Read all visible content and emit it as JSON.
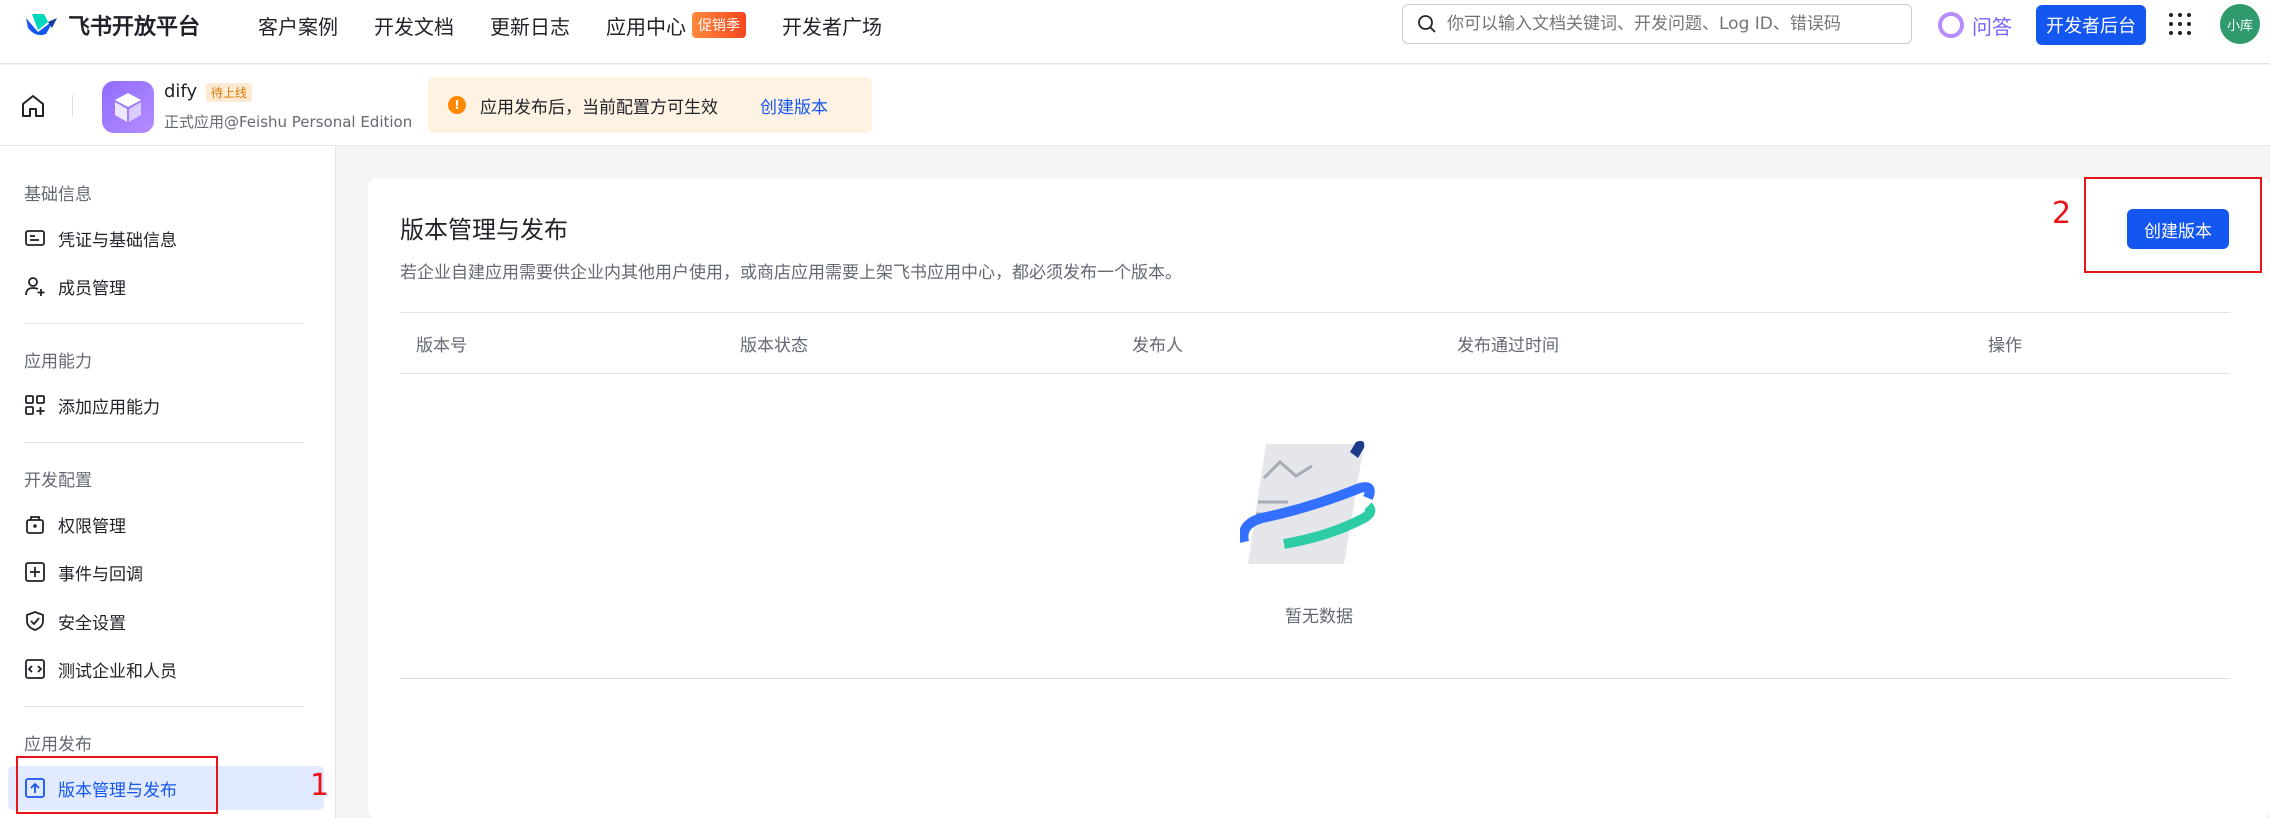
{
  "topbar": {
    "brand": "飞书开放平台",
    "nav": [
      {
        "label": "客户案例"
      },
      {
        "label": "开发文档"
      },
      {
        "label": "更新日志"
      },
      {
        "label": "应用中心",
        "badge": "促销季"
      },
      {
        "label": "开发者广场"
      }
    ],
    "search_placeholder": "你可以输入文档关键词、开发问题、Log ID、错误码",
    "ask_label": "问答",
    "dev_console_label": "开发者后台",
    "avatar_text": "小库"
  },
  "appbar": {
    "app_name": "dify",
    "app_status": "待上线",
    "app_subtitle": "正式应用@Feishu Personal Edition",
    "notice_text": "应用发布后，当前配置方可生效",
    "notice_link": "创建版本"
  },
  "sidebar": {
    "groups": [
      {
        "title": "基础信息",
        "items": [
          {
            "label": "凭证与基础信息",
            "icon": "id-card-icon"
          },
          {
            "label": "成员管理",
            "icon": "user-add-icon"
          }
        ]
      },
      {
        "title": "应用能力",
        "items": [
          {
            "label": "添加应用能力",
            "icon": "apps-add-icon"
          }
        ]
      },
      {
        "title": "开发配置",
        "items": [
          {
            "label": "权限管理",
            "icon": "lock-bag-icon"
          },
          {
            "label": "事件与回调",
            "icon": "event-icon"
          },
          {
            "label": "安全设置",
            "icon": "shield-icon"
          },
          {
            "label": "测试企业和人员",
            "icon": "code-icon"
          }
        ]
      },
      {
        "title": "应用发布",
        "items": [
          {
            "label": "版本管理与发布",
            "icon": "upload-icon",
            "active": true
          }
        ]
      }
    ]
  },
  "main": {
    "title": "版本管理与发布",
    "description": "若企业自建应用需要供企业内其他用户使用，或商店应用需要上架飞书应用中心，都必须发布一个版本。",
    "create_button": "创建版本",
    "columns": [
      "版本号",
      "版本状态",
      "发布人",
      "发布通过时间",
      "操作"
    ],
    "empty_text": "暂无数据"
  },
  "annotations": [
    "1",
    "2"
  ],
  "colors": {
    "primary": "#1456f0",
    "annotation": "#e8141a",
    "active_bg": "#e1eaff"
  }
}
